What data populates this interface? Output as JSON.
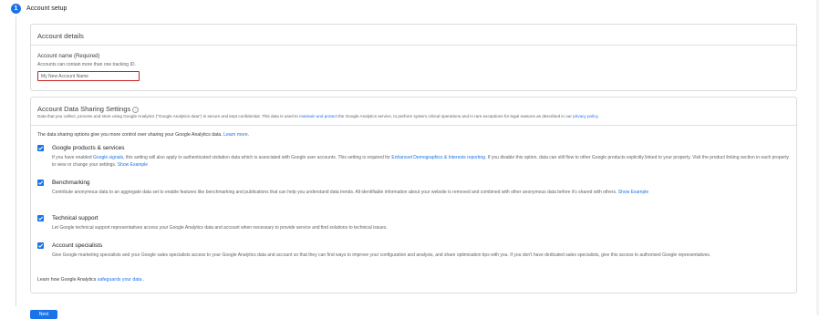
{
  "step": {
    "number": "1",
    "title": "Account setup"
  },
  "details": {
    "title": "Account details",
    "name_label": "Account name (Required)",
    "name_hint": "Accounts can contain more than one tracking ID.",
    "name_value": "My New Account Name"
  },
  "sharing": {
    "title": "Account Data Sharing Settings",
    "help_icon": "?",
    "intro_a": "Data that you collect, process and store using Google Analytics (\"Google Analytics data\") is secure and kept confidential. This data is used to ",
    "intro_link1": "maintain and protect",
    "intro_b": " the Google Analytics service, to perform system critical operations and in rare exceptions for legal reasons as described in our ",
    "intro_link2": "privacy policy",
    "intro_c": ".",
    "options_intro": "The data sharing options give you more control over sharing your Google Analytics data. ",
    "learn_more": "Learn more.",
    "options": [
      {
        "title": "Google products & services",
        "desc_a": "If you have enabled ",
        "link1": "Google signals",
        "desc_b": ", this setting will also apply to authenticated visitation data which is associated with Google user accounts. This setting is required for ",
        "link2": "Enhanced Demographics & Interests reporting",
        "desc_c": ". If you disable this option, data can still flow to other Google products explicitly linked to your property. Visit the product linking section in each property to view or change your settings. ",
        "link3": "Show Example"
      },
      {
        "title": "Benchmarking",
        "desc_a": "Contribute anonymous data to an aggregate data set to enable features like benchmarking and publications that can help you understand data trends. All identifiable information about your website is removed and combined with other anonymous data before it's shared with others. ",
        "link1": "Show Example"
      },
      {
        "title": "Technical support",
        "desc_a": "Let Google technical support representatives access your Google Analytics data and account when necessary to provide service and find solutions to technical issues."
      },
      {
        "title": "Account specialists",
        "desc_a": "Give Google marketing specialists and your Google sales specialists access to your Google Analytics data and account so that they can find ways to improve your configuration and analysis, and share optimisation tips with you. If you don't have dedicated sales specialists, give this access to authorised Google representatives."
      }
    ],
    "footer_a": "Learn how Google Analytics ",
    "footer_link": "safeguards your data",
    "footer_b": " ."
  },
  "buttons": {
    "next": "Next"
  },
  "colors": {
    "accent": "#1a73e8",
    "error": "#c5221f"
  },
  "icons": {
    "check": "checkmark-icon",
    "help": "help-circle-icon"
  }
}
